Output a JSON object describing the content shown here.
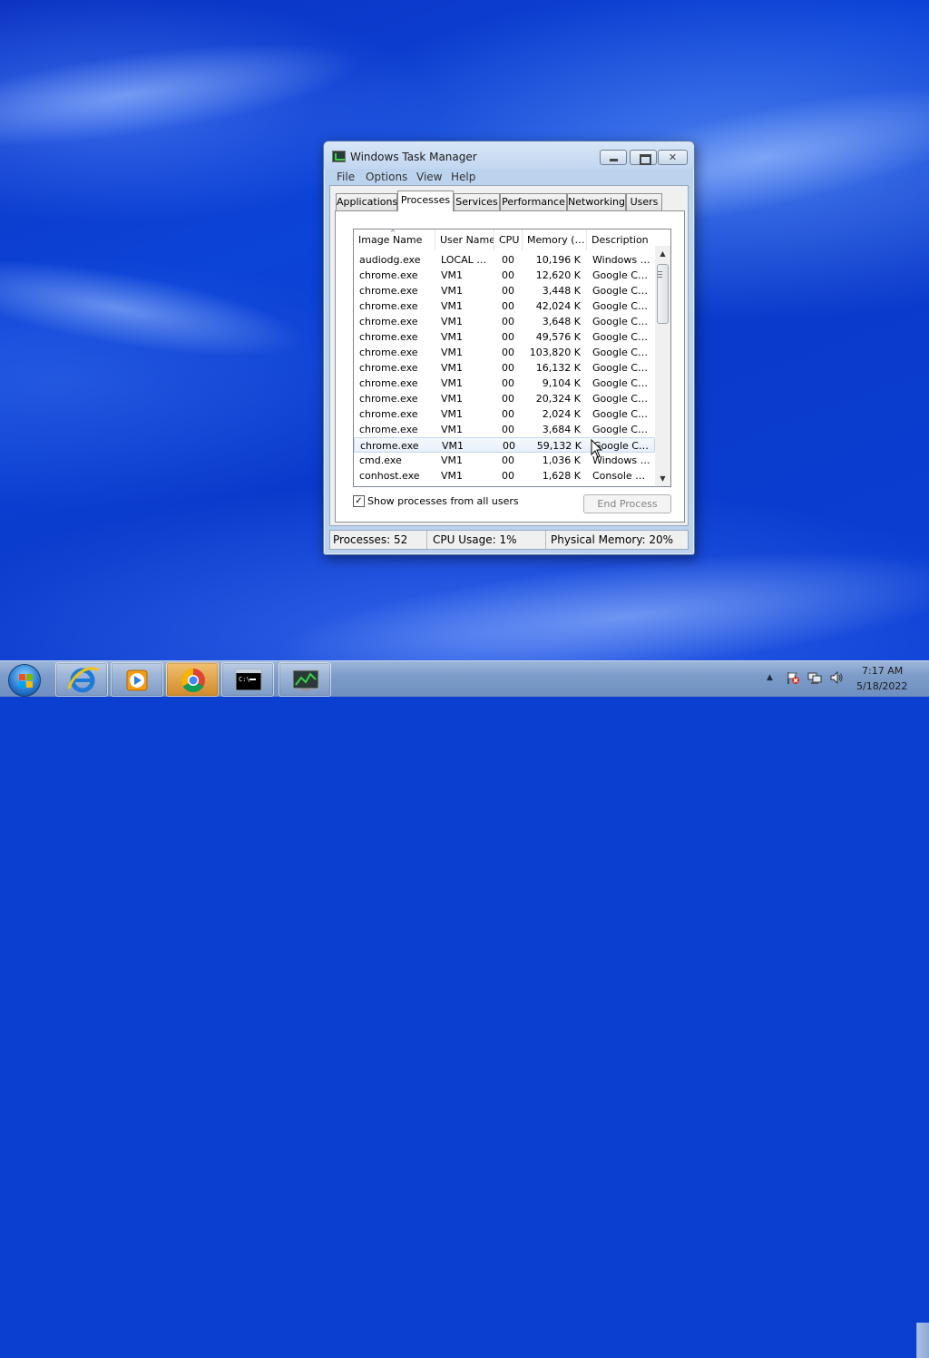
{
  "window": {
    "title": "Windows Task Manager",
    "menu": [
      "File",
      "Options",
      "View",
      "Help"
    ],
    "tabs": [
      "Applications",
      "Processes",
      "Services",
      "Performance",
      "Networking",
      "Users"
    ],
    "active_tab": "Processes"
  },
  "process_list": {
    "columns": [
      "Image Name",
      "User Name",
      "CPU",
      "Memory (…",
      "Description"
    ],
    "rows": [
      {
        "name": "audiodg.exe",
        "user": "LOCAL …",
        "cpu": "00",
        "mem": "10,196 K",
        "desc": "Windows …"
      },
      {
        "name": "chrome.exe",
        "user": "VM1",
        "cpu": "00",
        "mem": "12,620 K",
        "desc": "Google C…"
      },
      {
        "name": "chrome.exe",
        "user": "VM1",
        "cpu": "00",
        "mem": "3,448 K",
        "desc": "Google C…"
      },
      {
        "name": "chrome.exe",
        "user": "VM1",
        "cpu": "00",
        "mem": "42,024 K",
        "desc": "Google C…"
      },
      {
        "name": "chrome.exe",
        "user": "VM1",
        "cpu": "00",
        "mem": "3,648 K",
        "desc": "Google C…"
      },
      {
        "name": "chrome.exe",
        "user": "VM1",
        "cpu": "00",
        "mem": "49,576 K",
        "desc": "Google C…"
      },
      {
        "name": "chrome.exe",
        "user": "VM1",
        "cpu": "00",
        "mem": "103,820 K",
        "desc": "Google C…"
      },
      {
        "name": "chrome.exe",
        "user": "VM1",
        "cpu": "00",
        "mem": "16,132 K",
        "desc": "Google C…"
      },
      {
        "name": "chrome.exe",
        "user": "VM1",
        "cpu": "00",
        "mem": "9,104 K",
        "desc": "Google C…"
      },
      {
        "name": "chrome.exe",
        "user": "VM1",
        "cpu": "00",
        "mem": "20,324 K",
        "desc": "Google C…"
      },
      {
        "name": "chrome.exe",
        "user": "VM1",
        "cpu": "00",
        "mem": "2,024 K",
        "desc": "Google C…"
      },
      {
        "name": "chrome.exe",
        "user": "VM1",
        "cpu": "00",
        "mem": "3,684 K",
        "desc": "Google C…"
      },
      {
        "name": "chrome.exe",
        "user": "VM1",
        "cpu": "00",
        "mem": "59,132 K",
        "desc": "Google C…",
        "selected": true
      },
      {
        "name": "cmd.exe",
        "user": "VM1",
        "cpu": "00",
        "mem": "1,036 K",
        "desc": "Windows …"
      },
      {
        "name": "conhost.exe",
        "user": "VM1",
        "cpu": "00",
        "mem": "1,628 K",
        "desc": "Console …"
      }
    ]
  },
  "controls": {
    "show_all_label": "Show processes from all users",
    "show_all_checked": true,
    "checkmark": "✓",
    "end_process_label": "End Process"
  },
  "status": {
    "processes": "Processes: 52",
    "cpu": "CPU Usage: 1%",
    "memory": "Physical Memory: 20%"
  },
  "taskbar": {
    "pinned": [
      "start-orb",
      "internet-explorer-icon",
      "media-player-icon",
      "chrome-icon",
      "command-prompt-icon",
      "task-manager-icon"
    ],
    "time": "7:17 AM",
    "date": "5/18/2022"
  }
}
